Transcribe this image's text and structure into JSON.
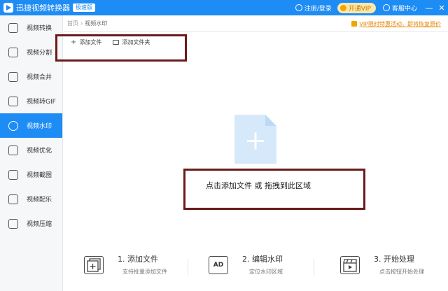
{
  "app": {
    "title": "迅捷视频转换器",
    "edition_badge": "极速版"
  },
  "titlebar": {
    "login_label": "注册/登录",
    "vip_label": "开通VIP",
    "service_label": "客服中心",
    "minimize": "—",
    "close": "✕"
  },
  "sidebar": {
    "items": [
      {
        "label": "视频转换",
        "icon": "video-convert-icon"
      },
      {
        "label": "视频分割",
        "icon": "video-split-icon"
      },
      {
        "label": "视频合并",
        "icon": "video-merge-icon"
      },
      {
        "label": "视频转GIF",
        "icon": "gif-icon"
      },
      {
        "label": "视频水印",
        "icon": "watermark-icon",
        "active": true
      },
      {
        "label": "视频优化",
        "icon": "optimize-icon"
      },
      {
        "label": "视频截图",
        "icon": "screenshot-icon"
      },
      {
        "label": "视频配乐",
        "icon": "music-icon"
      },
      {
        "label": "视频压缩",
        "icon": "compress-icon"
      }
    ]
  },
  "breadcrumb": {
    "home": "首页",
    "separator": "›",
    "current": "视频水印"
  },
  "promo": {
    "text": "VIP限时特惠活动，即将恢复原价"
  },
  "toolbar": {
    "add_file_icon": "+",
    "add_file": "添加文件",
    "add_folder": "添加文件夹"
  },
  "drop_zone": {
    "caption": "点击添加文件 或 拖拽到此区域"
  },
  "steps": [
    {
      "title": "1. 添加文件",
      "desc": "支持批量添加文件",
      "icon": "add-file-step-icon"
    },
    {
      "title": "2. 编辑水印",
      "desc": "定位水印区域",
      "icon_text": "AD",
      "icon": "ad-icon"
    },
    {
      "title": "3. 开始处理",
      "desc": "点击按钮开始处理",
      "icon": "clapperboard-icon"
    }
  ],
  "colors": {
    "accent": "#1e8cf5",
    "highlight_border": "#6b1a1a",
    "promo": "#e88400",
    "drop_file": "#d6e9fb"
  }
}
